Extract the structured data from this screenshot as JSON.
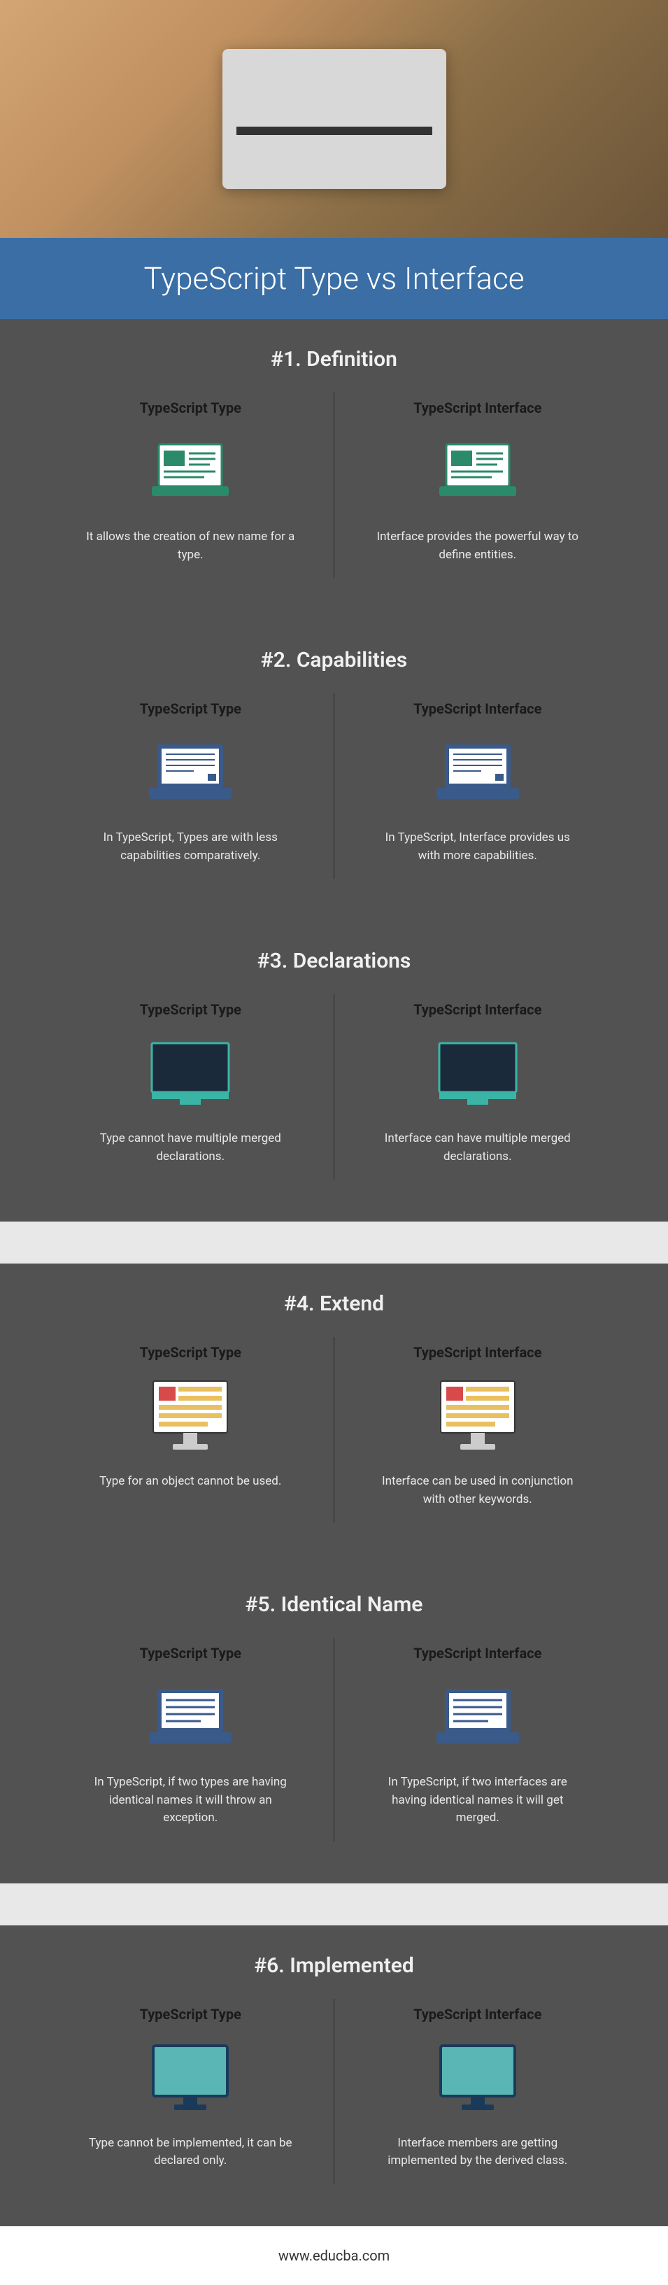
{
  "title": "TypeScript Type vs Interface",
  "footer": "www.educba.com",
  "left_label": "TypeScript Type",
  "right_label": "TypeScript Interface",
  "sections": [
    {
      "title": "#1. Definition",
      "left": "It allows the creation of new name for a type.",
      "right": "Interface provides the powerful way to define entities."
    },
    {
      "title": "#2. Capabilities",
      "left": "In TypeScript, Types are with less capabilities comparatively.",
      "right": "In TypeScript, Interface provides us with more capabilities."
    },
    {
      "title": "#3. Declarations",
      "left": "Type cannot have multiple merged declarations.",
      "right": "Interface can have multiple merged declarations."
    },
    {
      "title": "#4. Extend",
      "left": "Type for an object cannot be used.",
      "right": "Interface can be used in conjunction with other keywords."
    },
    {
      "title": "#5. Identical Name",
      "left": "In TypeScript, if two types are having identical names it will throw an exception.",
      "right": "In TypeScript, if two interfaces are having identical names it will get merged."
    },
    {
      "title": "#6. Implemented",
      "left": "Type cannot be implemented, it can be declared only.",
      "right": "Interface members are getting implemented by the derived class."
    }
  ]
}
